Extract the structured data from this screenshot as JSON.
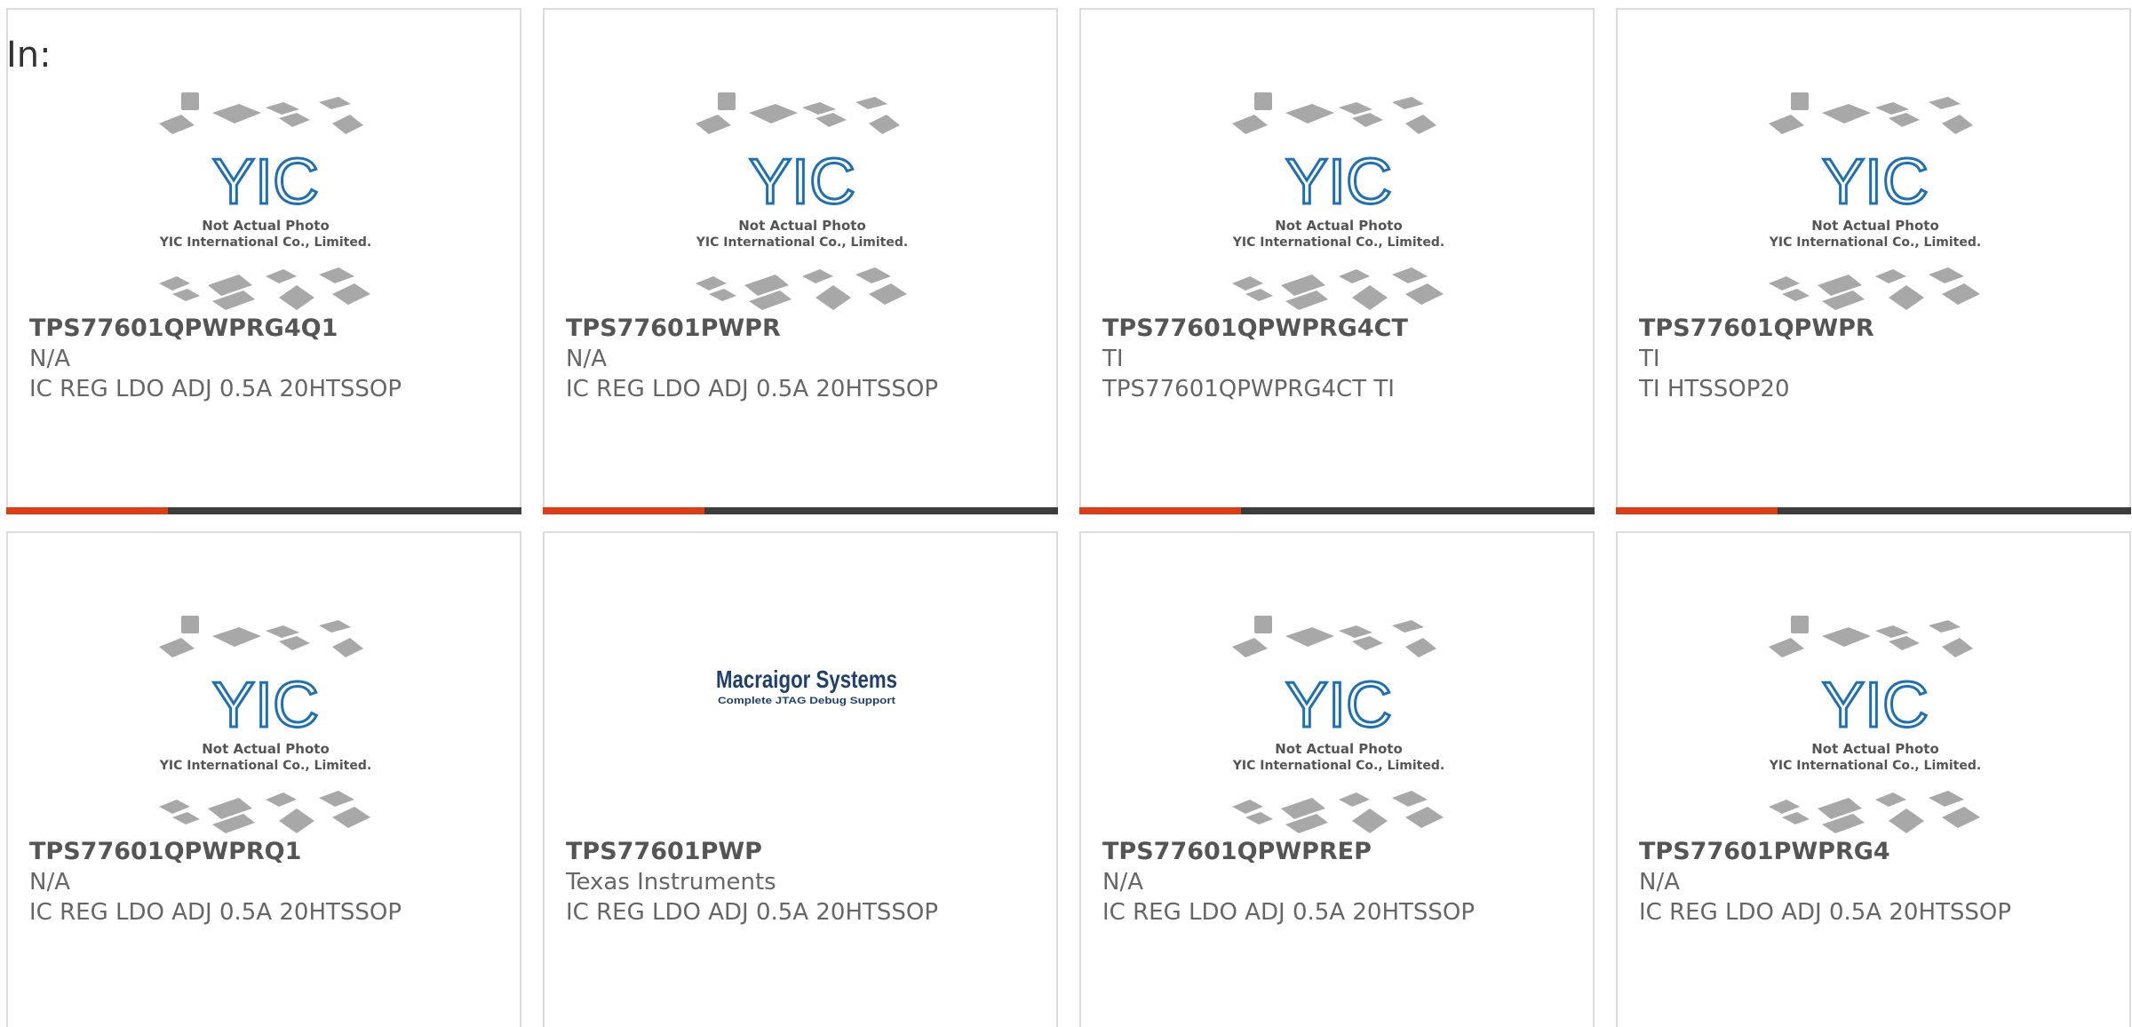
{
  "header": {
    "in_label": "In:"
  },
  "placeholder_image": {
    "caption_line1": "Not Actual Photo",
    "caption_line2": "YIC International Co., Limited.",
    "logo_text": "YIC",
    "colors": {
      "logo": "#1f6fb5",
      "chips": "#a8a8a8"
    }
  },
  "macraigor_logo": {
    "title": "Macraigor Systems",
    "subtitle": "Complete JTAG Debug Support",
    "color": "#1f3f6f"
  },
  "accent_color": "#e03c14",
  "products": [
    {
      "part_number": "TPS77601QPWPRG4Q1",
      "manufacturer": "N/A",
      "description": "IC REG LDO ADJ 0.5A 20HTSSOP",
      "image": "yic-placeholder"
    },
    {
      "part_number": "TPS77601PWPR",
      "manufacturer": "N/A",
      "description": "IC REG LDO ADJ 0.5A 20HTSSOP",
      "image": "yic-placeholder"
    },
    {
      "part_number": "TPS77601QPWPRG4CT",
      "manufacturer": "TI",
      "description": "TPS77601QPWPRG4CT TI",
      "image": "yic-placeholder"
    },
    {
      "part_number": "TPS77601QPWPR",
      "manufacturer": "TI",
      "description": "TI HTSSOP20",
      "image": "yic-placeholder"
    },
    {
      "part_number": "TPS77601QPWPRQ1",
      "manufacturer": "N/A",
      "description": "IC REG LDO ADJ 0.5A 20HTSSOP",
      "image": "yic-placeholder"
    },
    {
      "part_number": "TPS77601PWP",
      "manufacturer": "Texas Instruments",
      "description": "IC REG LDO ADJ 0.5A 20HTSSOP",
      "image": "macraigor-logo"
    },
    {
      "part_number": "TPS77601QPWPREP",
      "manufacturer": "N/A",
      "description": "IC REG LDO ADJ 0.5A 20HTSSOP",
      "image": "yic-placeholder"
    },
    {
      "part_number": "TPS77601PWPRG4",
      "manufacturer": "N/A",
      "description": "IC REG LDO ADJ 0.5A 20HTSSOP",
      "image": "yic-placeholder"
    }
  ]
}
